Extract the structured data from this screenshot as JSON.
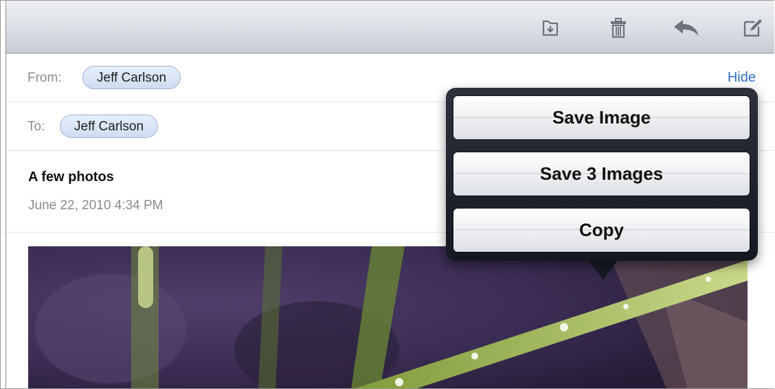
{
  "toolbar": {
    "icons": [
      "move-to-folder-icon",
      "trash-icon",
      "reply-icon",
      "compose-icon"
    ]
  },
  "header": {
    "from_label": "From:",
    "from_name": "Jeff Carlson",
    "to_label": "To:",
    "to_name": "Jeff Carlson",
    "hide_label": "Hide"
  },
  "message": {
    "subject": "A few photos",
    "date": "June 22, 2010 4:34 PM"
  },
  "popover": {
    "items": [
      "Save Image",
      "Save 3 Images",
      "Copy"
    ]
  },
  "colors": {
    "chip_fill": "#dbe5f6",
    "link_blue": "#2f6fc4",
    "popover_dark": "#1a1e26"
  }
}
